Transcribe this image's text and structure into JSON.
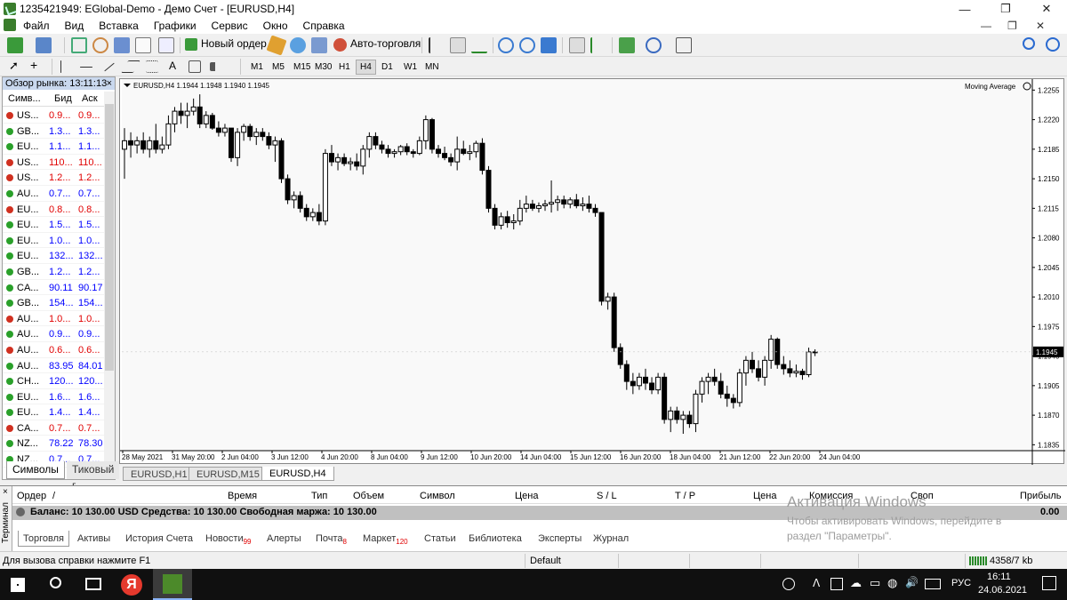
{
  "window": {
    "title": "1235421949: EGlobal-Demo - Демо Счет - [EURUSD,H4]",
    "min_glyph": "—",
    "max_glyph": "❐",
    "close_glyph": "✕"
  },
  "menu": {
    "items": [
      "Файл",
      "Вид",
      "Вставка",
      "Графики",
      "Сервис",
      "Окно",
      "Справка"
    ],
    "mdi_min": "—",
    "mdi_restore": "❐",
    "mdi_close": "✕"
  },
  "toolbar": {
    "new_order_label": "Новый ордер",
    "autotrade_label": "Авто-торговля",
    "text_tool": "A",
    "timeframes": [
      "M1",
      "M5",
      "M15",
      "M30",
      "H1",
      "H4",
      "D1",
      "W1",
      "MN"
    ],
    "active_timeframe": "H4"
  },
  "market_watch": {
    "header": "Обзор рынка: 13:11:13",
    "close": "×",
    "col_symbol": "Симв...",
    "col_bid": "Бид",
    "col_ask": "Аск",
    "rows": [
      {
        "symbol": "US...",
        "bid": "0.9...",
        "ask": "0.9...",
        "dir": "down",
        "color": "red"
      },
      {
        "symbol": "GB...",
        "bid": "1.3...",
        "ask": "1.3...",
        "dir": "up",
        "color": "blue"
      },
      {
        "symbol": "EU...",
        "bid": "1.1...",
        "ask": "1.1...",
        "dir": "up",
        "color": "blue"
      },
      {
        "symbol": "US...",
        "bid": "110...",
        "ask": "110...",
        "dir": "down",
        "color": "red"
      },
      {
        "symbol": "US...",
        "bid": "1.2...",
        "ask": "1.2...",
        "dir": "down",
        "color": "red"
      },
      {
        "symbol": "AU...",
        "bid": "0.7...",
        "ask": "0.7...",
        "dir": "up",
        "color": "blue"
      },
      {
        "symbol": "EU...",
        "bid": "0.8...",
        "ask": "0.8...",
        "dir": "down",
        "color": "red"
      },
      {
        "symbol": "EU...",
        "bid": "1.5...",
        "ask": "1.5...",
        "dir": "up",
        "color": "blue"
      },
      {
        "symbol": "EU...",
        "bid": "1.0...",
        "ask": "1.0...",
        "dir": "up",
        "color": "blue"
      },
      {
        "symbol": "EU...",
        "bid": "132...",
        "ask": "132...",
        "dir": "up",
        "color": "blue"
      },
      {
        "symbol": "GB...",
        "bid": "1.2...",
        "ask": "1.2...",
        "dir": "up",
        "color": "blue"
      },
      {
        "symbol": "CA...",
        "bid": "90.11",
        "ask": "90.17",
        "dir": "up",
        "color": "blue"
      },
      {
        "symbol": "GB...",
        "bid": "154...",
        "ask": "154...",
        "dir": "up",
        "color": "blue"
      },
      {
        "symbol": "AU...",
        "bid": "1.0...",
        "ask": "1.0...",
        "dir": "down",
        "color": "red"
      },
      {
        "symbol": "AU...",
        "bid": "0.9...",
        "ask": "0.9...",
        "dir": "up",
        "color": "blue"
      },
      {
        "symbol": "AU...",
        "bid": "0.6...",
        "ask": "0.6...",
        "dir": "down",
        "color": "red"
      },
      {
        "symbol": "AU...",
        "bid": "83.95",
        "ask": "84.01",
        "dir": "up",
        "color": "blue"
      },
      {
        "symbol": "CH...",
        "bid": "120...",
        "ask": "120...",
        "dir": "up",
        "color": "blue"
      },
      {
        "symbol": "EU...",
        "bid": "1.6...",
        "ask": "1.6...",
        "dir": "up",
        "color": "blue"
      },
      {
        "symbol": "EU...",
        "bid": "1.4...",
        "ask": "1.4...",
        "dir": "up",
        "color": "blue"
      },
      {
        "symbol": "CA...",
        "bid": "0.7...",
        "ask": "0.7...",
        "dir": "down",
        "color": "red"
      },
      {
        "symbol": "NZ...",
        "bid": "78.22",
        "ask": "78.30",
        "dir": "up",
        "color": "blue"
      },
      {
        "symbol": "NZ...",
        "bid": "0.7...",
        "ask": "0.7...",
        "dir": "up",
        "color": "blue"
      }
    ],
    "tab_symbols": "Символы",
    "tab_ticks": "Тиковый г"
  },
  "chart": {
    "info": "EURUSD,H4  1.1944 1.1948 1.1940 1.1945",
    "indicator": "Moving Average",
    "current_price": "1.1945",
    "up_color": "#ffffff",
    "down_color": "#000000"
  },
  "chart_data": {
    "type": "candlestick",
    "symbol": "EURUSD",
    "timeframe": "H4",
    "y_ticks": [
      "1.2255",
      "1.2220",
      "1.2185",
      "1.2150",
      "1.2115",
      "1.2080",
      "1.2045",
      "1.2010",
      "1.1975",
      "1.1940",
      "1.1905",
      "1.1870",
      "1.1835"
    ],
    "x_ticks": [
      "28 May 2021",
      "31 May 20:00",
      "2 Jun 04:00",
      "3 Jun 12:00",
      "4 Jun 20:00",
      "8 Jun 04:00",
      "9 Jun 12:00",
      "10 Jun 20:00",
      "14 Jun 04:00",
      "15 Jun 12:00",
      "16 Jun 20:00",
      "18 Jun 04:00",
      "21 Jun 12:00",
      "22 Jun 20:00",
      "24 Jun 04:00"
    ],
    "ylim": [
      1.1828,
      1.2268
    ],
    "ohlc": [
      [
        1.2185,
        1.221,
        1.215,
        1.2195
      ],
      [
        1.2195,
        1.2205,
        1.2175,
        1.219
      ],
      [
        1.219,
        1.22,
        1.218,
        1.2195
      ],
      [
        1.2195,
        1.2205,
        1.218,
        1.2185
      ],
      [
        1.2185,
        1.22,
        1.2175,
        1.2195
      ],
      [
        1.2195,
        1.2215,
        1.218,
        1.2185
      ],
      [
        1.2185,
        1.22,
        1.218,
        1.219
      ],
      [
        1.219,
        1.2225,
        1.2185,
        1.2215
      ],
      [
        1.2215,
        1.2235,
        1.2205,
        1.223
      ],
      [
        1.223,
        1.224,
        1.2215,
        1.2225
      ],
      [
        1.2225,
        1.224,
        1.221,
        1.223
      ],
      [
        1.223,
        1.2245,
        1.2225,
        1.2235
      ],
      [
        1.2235,
        1.225,
        1.221,
        1.2215
      ],
      [
        1.2215,
        1.223,
        1.221,
        1.2225
      ],
      [
        1.2225,
        1.2228,
        1.2208,
        1.221
      ],
      [
        1.221,
        1.2218,
        1.22,
        1.2205
      ],
      [
        1.2205,
        1.2215,
        1.22,
        1.221
      ],
      [
        1.221,
        1.221,
        1.217,
        1.2175
      ],
      [
        1.2175,
        1.221,
        1.2165,
        1.2205
      ],
      [
        1.2205,
        1.2215,
        1.2195,
        1.2212
      ],
      [
        1.2212,
        1.2215,
        1.2195,
        1.22
      ],
      [
        1.22,
        1.221,
        1.219,
        1.2205
      ],
      [
        1.2205,
        1.221,
        1.2195,
        1.22
      ],
      [
        1.22,
        1.2205,
        1.2185,
        1.219
      ],
      [
        1.219,
        1.22,
        1.217,
        1.2195
      ],
      [
        1.2195,
        1.2198,
        1.2145,
        1.215
      ],
      [
        1.215,
        1.2155,
        1.212,
        1.2125
      ],
      [
        1.2125,
        1.2135,
        1.2115,
        1.213
      ],
      [
        1.213,
        1.2135,
        1.211,
        1.2115
      ],
      [
        1.2115,
        1.212,
        1.21,
        1.2105
      ],
      [
        1.2105,
        1.2115,
        1.21,
        1.211
      ],
      [
        1.211,
        1.212,
        1.2095,
        1.21
      ],
      [
        1.21,
        1.2185,
        1.2095,
        1.218
      ],
      [
        1.218,
        1.219,
        1.2165,
        1.217
      ],
      [
        1.217,
        1.218,
        1.216,
        1.2175
      ],
      [
        1.2175,
        1.218,
        1.2165,
        1.2168
      ],
      [
        1.2168,
        1.2175,
        1.216,
        1.217
      ],
      [
        1.217,
        1.218,
        1.216,
        1.2165
      ],
      [
        1.2165,
        1.219,
        1.2155,
        1.2185
      ],
      [
        1.2185,
        1.2205,
        1.2175,
        1.22
      ],
      [
        1.22,
        1.2205,
        1.2185,
        1.219
      ],
      [
        1.219,
        1.2195,
        1.218,
        1.2185
      ],
      [
        1.2185,
        1.219,
        1.2175,
        1.218
      ],
      [
        1.218,
        1.2185,
        1.2175,
        1.2182
      ],
      [
        1.2182,
        1.219,
        1.2178,
        1.2188
      ],
      [
        1.2188,
        1.2192,
        1.2178,
        1.2182
      ],
      [
        1.2182,
        1.2185,
        1.2175,
        1.218
      ],
      [
        1.218,
        1.22,
        1.2178,
        1.2195
      ],
      [
        1.2195,
        1.2225,
        1.2185,
        1.222
      ],
      [
        1.222,
        1.2222,
        1.218,
        1.2185
      ],
      [
        1.2185,
        1.219,
        1.2175,
        1.218
      ],
      [
        1.218,
        1.2188,
        1.2172,
        1.2175
      ],
      [
        1.2175,
        1.218,
        1.2165,
        1.217
      ],
      [
        1.217,
        1.22,
        1.216,
        1.2185
      ],
      [
        1.2185,
        1.2195,
        1.2178,
        1.218
      ],
      [
        1.218,
        1.219,
        1.2172,
        1.2182
      ],
      [
        1.2182,
        1.2195,
        1.2175,
        1.2192
      ],
      [
        1.2192,
        1.2198,
        1.2155,
        1.216
      ],
      [
        1.216,
        1.2165,
        1.211,
        1.2115
      ],
      [
        1.2115,
        1.212,
        1.209,
        1.2095
      ],
      [
        1.2095,
        1.211,
        1.209,
        1.2105
      ],
      [
        1.2105,
        1.2112,
        1.2092,
        1.2098
      ],
      [
        1.2098,
        1.2108,
        1.209,
        1.21
      ],
      [
        1.21,
        1.2125,
        1.2095,
        1.2115
      ],
      [
        1.2115,
        1.213,
        1.211,
        1.212
      ],
      [
        1.212,
        1.2125,
        1.2112,
        1.2115
      ],
      [
        1.2115,
        1.2122,
        1.211,
        1.2118
      ],
      [
        1.2118,
        1.2125,
        1.2112,
        1.212
      ],
      [
        1.212,
        1.2148,
        1.211,
        1.2122
      ],
      [
        1.2122,
        1.213,
        1.2112,
        1.2125
      ],
      [
        1.2125,
        1.213,
        1.2115,
        1.212
      ],
      [
        1.212,
        1.2128,
        1.2115,
        1.2125
      ],
      [
        1.2125,
        1.2132,
        1.2115,
        1.2118
      ],
      [
        1.2118,
        1.2128,
        1.2112,
        1.212
      ],
      [
        1.212,
        1.213,
        1.211,
        1.2115
      ],
      [
        1.2115,
        1.212,
        1.2105,
        1.211
      ],
      [
        1.211,
        1.211,
        1.2,
        1.2005
      ],
      [
        1.2005,
        1.2015,
        1.1995,
        1.201
      ],
      [
        1.201,
        1.2015,
        1.1945,
        1.195
      ],
      [
        1.195,
        1.1955,
        1.1925,
        1.193
      ],
      [
        1.193,
        1.1935,
        1.19,
        1.191
      ],
      [
        1.191,
        1.192,
        1.1895,
        1.1905
      ],
      [
        1.1905,
        1.192,
        1.19,
        1.1915
      ],
      [
        1.1915,
        1.1925,
        1.19,
        1.1908
      ],
      [
        1.1908,
        1.1915,
        1.1895,
        1.19
      ],
      [
        1.19,
        1.192,
        1.1895,
        1.1915
      ],
      [
        1.1915,
        1.192,
        1.186,
        1.1865
      ],
      [
        1.1865,
        1.188,
        1.185,
        1.1875
      ],
      [
        1.1875,
        1.188,
        1.186,
        1.1865
      ],
      [
        1.1865,
        1.1875,
        1.1848,
        1.187
      ],
      [
        1.187,
        1.1875,
        1.1855,
        1.186
      ],
      [
        1.186,
        1.19,
        1.185,
        1.1895
      ],
      [
        1.1895,
        1.1915,
        1.1885,
        1.191
      ],
      [
        1.191,
        1.192,
        1.1895,
        1.1915
      ],
      [
        1.1915,
        1.1925,
        1.1905,
        1.191
      ],
      [
        1.191,
        1.192,
        1.189,
        1.1895
      ],
      [
        1.1895,
        1.1905,
        1.188,
        1.189
      ],
      [
        1.189,
        1.1895,
        1.1878,
        1.1885
      ],
      [
        1.1885,
        1.1925,
        1.188,
        1.192
      ],
      [
        1.192,
        1.194,
        1.1905,
        1.1935
      ],
      [
        1.1935,
        1.1945,
        1.192,
        1.1925
      ],
      [
        1.1925,
        1.1935,
        1.191,
        1.1915
      ],
      [
        1.1915,
        1.194,
        1.1905,
        1.1935
      ],
      [
        1.1935,
        1.1965,
        1.1925,
        1.196
      ],
      [
        1.196,
        1.1962,
        1.1925,
        1.193
      ],
      [
        1.193,
        1.194,
        1.1918,
        1.1925
      ],
      [
        1.1925,
        1.1935,
        1.1915,
        1.192
      ],
      [
        1.192,
        1.193,
        1.1915,
        1.1922
      ],
      [
        1.1922,
        1.1925,
        1.1912,
        1.1918
      ],
      [
        1.1918,
        1.195,
        1.1915,
        1.1945
      ],
      [
        1.1944,
        1.1948,
        1.194,
        1.1945
      ]
    ]
  },
  "chart_tabs": [
    "EURUSD,H1",
    "EURUSD,M15",
    "EURUSD,H4"
  ],
  "chart_tab_active": "EURUSD,H4",
  "terminal": {
    "side_label": "Терминал",
    "close": "×",
    "columns": [
      "Ордер",
      "/",
      "Время",
      "Тип",
      "Объем",
      "Символ",
      "Цена",
      "S / L",
      "T / P",
      "Цена",
      "Комиссия",
      "Своп",
      "Прибыль"
    ],
    "balance_label": "Баланс: 10 130.00 USD  Средства: 10 130.00  Свободная маржа: 10 130.00",
    "profit_total": "0.00",
    "tabs": [
      {
        "label": "Торговля",
        "badge": ""
      },
      {
        "label": "Активы",
        "badge": ""
      },
      {
        "label": "История Счета",
        "badge": ""
      },
      {
        "label": "Новости",
        "badge": "99"
      },
      {
        "label": "Алерты",
        "badge": ""
      },
      {
        "label": "Почта",
        "badge": "8"
      },
      {
        "label": "Маркет",
        "badge": "120"
      },
      {
        "label": "Статьи",
        "badge": ""
      },
      {
        "label": "Библиотека",
        "badge": ""
      },
      {
        "label": "Эксперты",
        "badge": ""
      },
      {
        "label": "Журнал",
        "badge": ""
      }
    ],
    "watermark_title": "Активация Windows",
    "watermark_line1": "Чтобы активировать Windows, перейдите в",
    "watermark_line2": "раздел \"Параметры\"."
  },
  "statusbar": {
    "help": "Для вызова справки нажмите F1",
    "profile": "Default",
    "traffic": "4358/7 kb"
  },
  "taskbar": {
    "lang": "РУС",
    "time": "16:11",
    "date": "24.06.2021",
    "yandex_letter": "Я",
    "tray_glyphs": [
      "ᐱ",
      "☁",
      "▭",
      "◍",
      "🔊"
    ]
  }
}
